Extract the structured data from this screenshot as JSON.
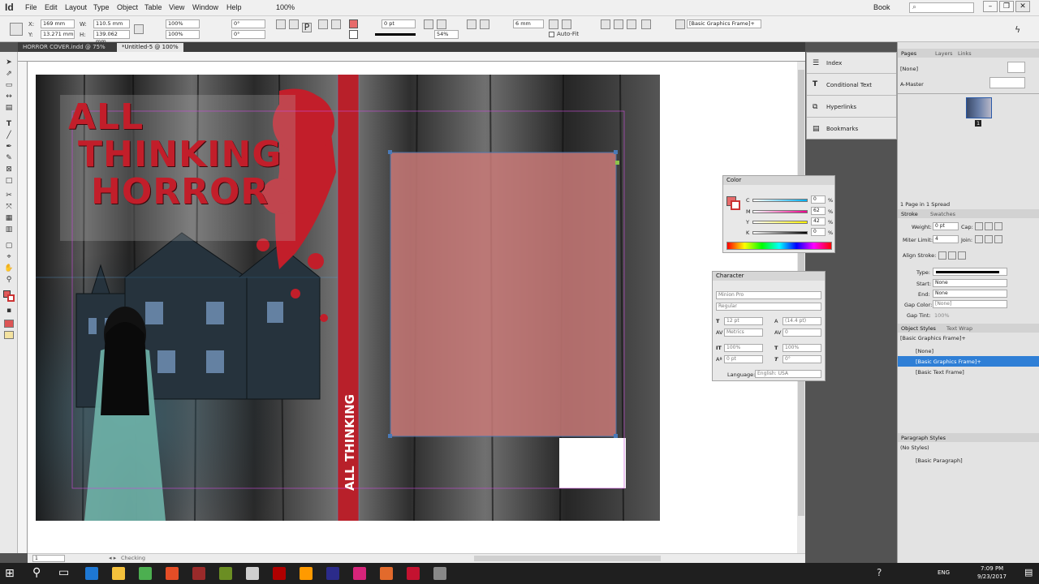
{
  "app": {
    "logo": "Id"
  },
  "menubar": {
    "items": [
      "File",
      "Edit",
      "Layout",
      "Type",
      "Object",
      "Table",
      "View",
      "Window",
      "Help"
    ],
    "zoom": "100%",
    "workspace": "Book"
  },
  "control": {
    "x_label": "X:",
    "x_value": "169 mm",
    "y_label": "Y:",
    "y_value": "13.271 mm",
    "w_label": "W:",
    "w_value": "110.5 mm",
    "h_label": "H:",
    "h_value": "139.062 mm",
    "scale_x": "100%",
    "scale_y": "100%",
    "rotate": "0°",
    "shear": "0°",
    "stroke_weight": "0 pt",
    "opacity": "54%",
    "gap": "6 mm",
    "autofit": "Auto-Fit",
    "object_style": "[Basic Graphics Frame]+"
  },
  "tabs": [
    {
      "label": "HORROR COVER.indd @ 75%"
    },
    {
      "label": "*Untitled-5 @ 100%"
    }
  ],
  "cover": {
    "title_line1": "ALL",
    "title_line2": "THINKING",
    "title_line3": "HORROR",
    "spine_text": "ALL THINKING",
    "colors": {
      "blood": "#c21e2a",
      "pink_overlay": "#c97a78",
      "spine": "#b8202a"
    }
  },
  "float_panels": {
    "items": [
      "Index",
      "Conditional Text",
      "Hyperlinks",
      "Bookmarks"
    ]
  },
  "color_panel": {
    "title": "Color",
    "channels": [
      {
        "label": "C",
        "value": "0"
      },
      {
        "label": "M",
        "value": "62"
      },
      {
        "label": "Y",
        "value": "42"
      },
      {
        "label": "K",
        "value": "0"
      }
    ],
    "percent": "%"
  },
  "character_panel": {
    "title": "Character",
    "font": "Minion Pro",
    "style": "Regular",
    "size": "12 pt",
    "leading": "(14.4 pt)",
    "kerning": "Metrics",
    "tracking": "0",
    "vscale": "100%",
    "hscale": "100%",
    "baseline": "0 pt",
    "skew": "0°",
    "language_label": "Language:",
    "language": "English: USA"
  },
  "pages_panel": {
    "tabs": [
      "Pages",
      "Layers",
      "Links"
    ],
    "none": "[None]",
    "master": "A-Master",
    "page_number": "1",
    "status": "1 Page in 1 Spread"
  },
  "stroke_panel": {
    "tabs": [
      "Stroke",
      "Swatches"
    ],
    "weight_label": "Weight:",
    "weight": "0 pt",
    "cap_label": "Cap:",
    "miter_label": "Miter Limit:",
    "miter": "4",
    "join_label": "Join:",
    "align_label": "Align Stroke:",
    "type_label": "Type:",
    "start_label": "Start:",
    "start": "None",
    "end_label": "End:",
    "end": "None",
    "gap_color_label": "Gap Color:",
    "gap_color": "[None]",
    "gap_tint_label": "Gap Tint:",
    "gap_tint": "100%"
  },
  "object_styles": {
    "tabs": [
      "Object Styles",
      "Text Wrap"
    ],
    "current": "[Basic Graphics Frame]+",
    "items": [
      "[None]",
      "[Basic Graphics Frame]+",
      "[Basic Text Frame]"
    ],
    "selected_index": 1
  },
  "paragraph_styles": {
    "title": "Paragraph Styles",
    "current": "(No Styles)",
    "items": [
      "[Basic Paragraph]"
    ]
  },
  "statusbar": {
    "page": "1",
    "preflight": "Checking"
  },
  "taskbar": {
    "language": "ENG",
    "time": "7:09 PM",
    "date": "9/23/2017",
    "app_colors": [
      "#1e78d4",
      "#f4c13c",
      "#4caf50",
      "#e44d26",
      "#9a2a2a",
      "#6b8e23",
      "#cfcfcf",
      "#b00000",
      "#ff9a00",
      "#2b2b8a",
      "#d6247a",
      "#e26a2c",
      "#c41230",
      "#888888"
    ]
  }
}
